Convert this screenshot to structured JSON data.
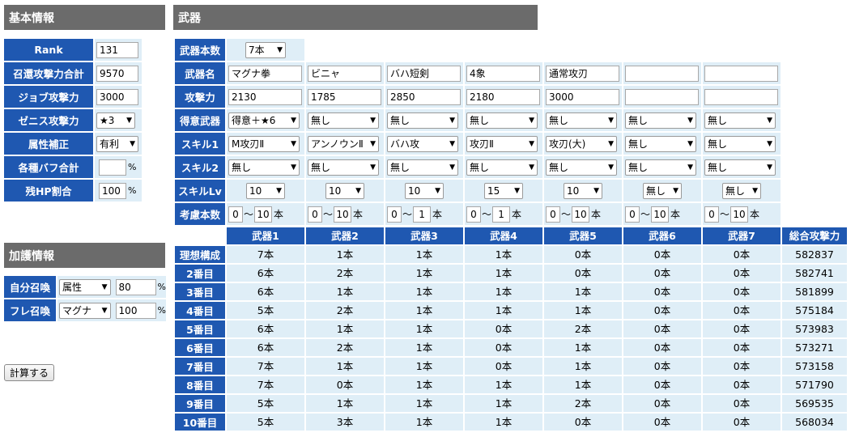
{
  "basic": {
    "title": "基本情報",
    "rank_label": "Rank",
    "rank_value": "131",
    "summon_label": "召還攻撃力合計",
    "summon_value": "9570",
    "job_label": "ジョブ攻撃力",
    "job_value": "3000",
    "zenith_label": "ゼニス攻撃力",
    "zenith_value": "★3",
    "element_label": "属性補正",
    "element_value": "有利",
    "buff_label": "各種バフ合計",
    "buff_value": "",
    "buff_unit": "%",
    "hp_label": "残HP割合",
    "hp_value": "100",
    "hp_unit": "%"
  },
  "kago": {
    "title": "加護情報",
    "self_label": "自分召喚",
    "self_type": "属性",
    "self_value": "80",
    "self_unit": "%",
    "friend_label": "フレ召喚",
    "friend_type": "マグナ",
    "friend_value": "100",
    "friend_unit": "%"
  },
  "calc_button": "計算する",
  "weapons": {
    "title": "武器",
    "count_label": "武器本数",
    "count_value": "7本",
    "name_label": "武器名",
    "names": [
      "マグナ拳",
      "ビニャ",
      "バハ短剣",
      "4象",
      "通常攻刃",
      "",
      ""
    ],
    "atk_label": "攻撃力",
    "atks": [
      "2130",
      "1785",
      "2850",
      "2180",
      "3000",
      "",
      ""
    ],
    "favor_label": "得意武器",
    "favors": [
      "得意＋★6",
      "無し",
      "無し",
      "無し",
      "無し",
      "無し",
      "無し"
    ],
    "skill1_label": "スキル1",
    "skill1": [
      "M攻刃Ⅱ",
      "アンノウンⅡ",
      "バハ攻",
      "攻刃Ⅱ",
      "攻刃(大)",
      "無し",
      "無し"
    ],
    "skill2_label": "スキル2",
    "skill2": [
      "無し",
      "無し",
      "無し",
      "無し",
      "無し",
      "無し",
      "無し"
    ],
    "skilllv_label": "スキルLv",
    "skilllv": [
      "10",
      "10",
      "10",
      "15",
      "10",
      "無し",
      "無し"
    ],
    "range_label": "考慮本数",
    "range_min": [
      "0",
      "0",
      "0",
      "0",
      "0",
      "0",
      "0"
    ],
    "range_sep": "～",
    "range_max": [
      "10",
      "10",
      "1",
      "1",
      "10",
      "10",
      "10"
    ],
    "range_unit": "本"
  },
  "results": {
    "headers": [
      "武器1",
      "武器2",
      "武器3",
      "武器4",
      "武器5",
      "武器6",
      "武器7",
      "総合攻撃力"
    ],
    "rows": [
      {
        "label": "理想構成",
        "cells": [
          "7本",
          "1本",
          "1本",
          "1本",
          "0本",
          "0本",
          "0本",
          "582837"
        ]
      },
      {
        "label": "2番目",
        "cells": [
          "6本",
          "2本",
          "1本",
          "1本",
          "0本",
          "0本",
          "0本",
          "582741"
        ]
      },
      {
        "label": "3番目",
        "cells": [
          "6本",
          "1本",
          "1本",
          "1本",
          "1本",
          "0本",
          "0本",
          "581899"
        ]
      },
      {
        "label": "4番目",
        "cells": [
          "5本",
          "2本",
          "1本",
          "1本",
          "1本",
          "0本",
          "0本",
          "575184"
        ]
      },
      {
        "label": "5番目",
        "cells": [
          "6本",
          "1本",
          "1本",
          "0本",
          "2本",
          "0本",
          "0本",
          "573983"
        ]
      },
      {
        "label": "6番目",
        "cells": [
          "6本",
          "2本",
          "1本",
          "0本",
          "1本",
          "0本",
          "0本",
          "573271"
        ]
      },
      {
        "label": "7番目",
        "cells": [
          "7本",
          "1本",
          "1本",
          "0本",
          "1本",
          "0本",
          "0本",
          "573158"
        ]
      },
      {
        "label": "8番目",
        "cells": [
          "7本",
          "0本",
          "1本",
          "1本",
          "1本",
          "0本",
          "0本",
          "571790"
        ]
      },
      {
        "label": "9番目",
        "cells": [
          "5本",
          "1本",
          "1本",
          "1本",
          "2本",
          "0本",
          "0本",
          "569535"
        ]
      },
      {
        "label": "10番目",
        "cells": [
          "5本",
          "3本",
          "1本",
          "1本",
          "0本",
          "0本",
          "0本",
          "568034"
        ]
      }
    ]
  },
  "icons": {
    "dropdown": "chevron-down-icon"
  },
  "colors": {
    "label_bg": "#1f58b1",
    "cell_bg": "#dfeef7",
    "title_bg": "#6b6b6b"
  }
}
